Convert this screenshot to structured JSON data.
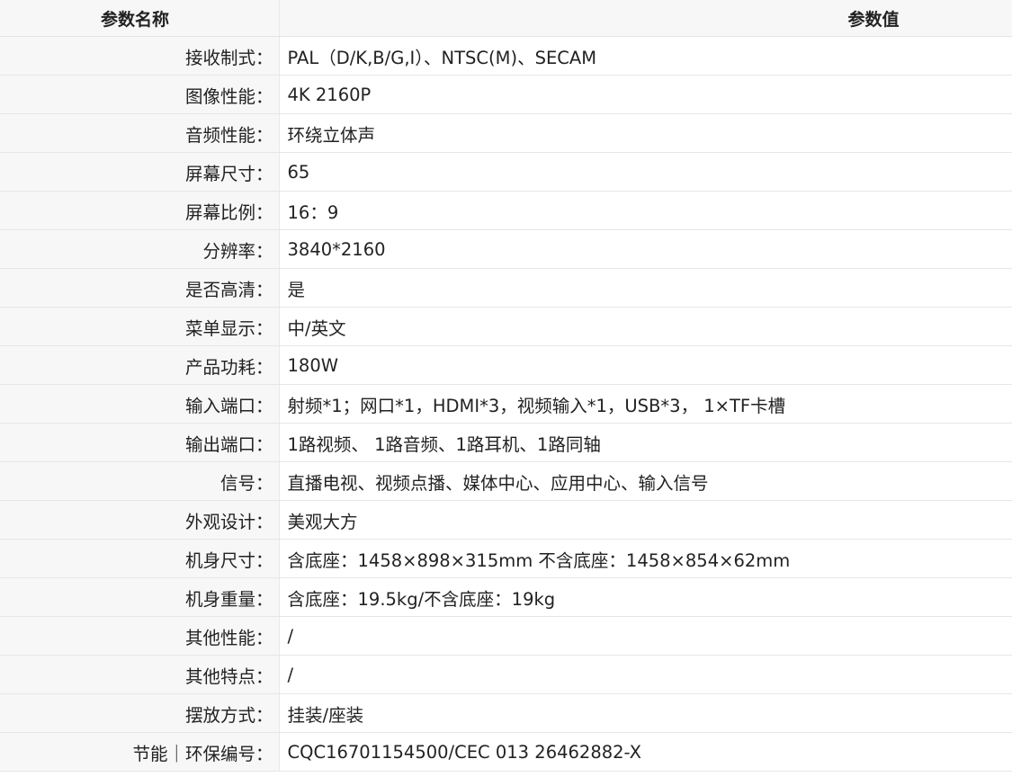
{
  "table": {
    "header_name": "参数名称",
    "header_value": "参数值",
    "rows": [
      {
        "label": "接收制式：",
        "value": "PAL（D/K,B/G,I）、NTSC(M)、SECAM"
      },
      {
        "label": "图像性能：",
        "value": "4K 2160P"
      },
      {
        "label": "音频性能：",
        "value": "环绕立体声"
      },
      {
        "label": "屏幕尺寸：",
        "value": "65"
      },
      {
        "label": "屏幕比例：",
        "value": "16：9"
      },
      {
        "label": "分辨率：",
        "value": "3840*2160"
      },
      {
        "label": "是否高清：",
        "value": "是"
      },
      {
        "label": "菜单显示：",
        "value": "中/英文"
      },
      {
        "label": "产品功耗：",
        "value": "180W"
      },
      {
        "label": "输入端口：",
        "value": "射频*1；网口*1，HDMI*3，视频输入*1，USB*3， 1×TF卡槽"
      },
      {
        "label": "输出端口：",
        "value": "1路视频、 1路音频、1路耳机、1路同轴"
      },
      {
        "label": "信号：",
        "value": "直播电视、视频点播、媒体中心、应用中心、输入信号"
      },
      {
        "label": "外观设计：",
        "value": "美观大方"
      },
      {
        "label": "机身尺寸：",
        "value": "含底座：1458×898×315mm 不含底座：1458×854×62mm"
      },
      {
        "label": "机身重量：",
        "value": "含底座：19.5kg/不含底座：19kg"
      },
      {
        "label": "其他性能：",
        "value": "/"
      },
      {
        "label": "其他特点：",
        "value": "/"
      },
      {
        "label": "摆放方式：",
        "value": "挂装/座装"
      },
      {
        "label": "节能｜环保编号：",
        "value": "CQC16701154500/CEC 013 26462882-X"
      }
    ]
  },
  "colors": {
    "label_background": "#f7f7f7",
    "value_background": "#ffffff",
    "border": "#e6e6e6",
    "text": "#222222"
  }
}
